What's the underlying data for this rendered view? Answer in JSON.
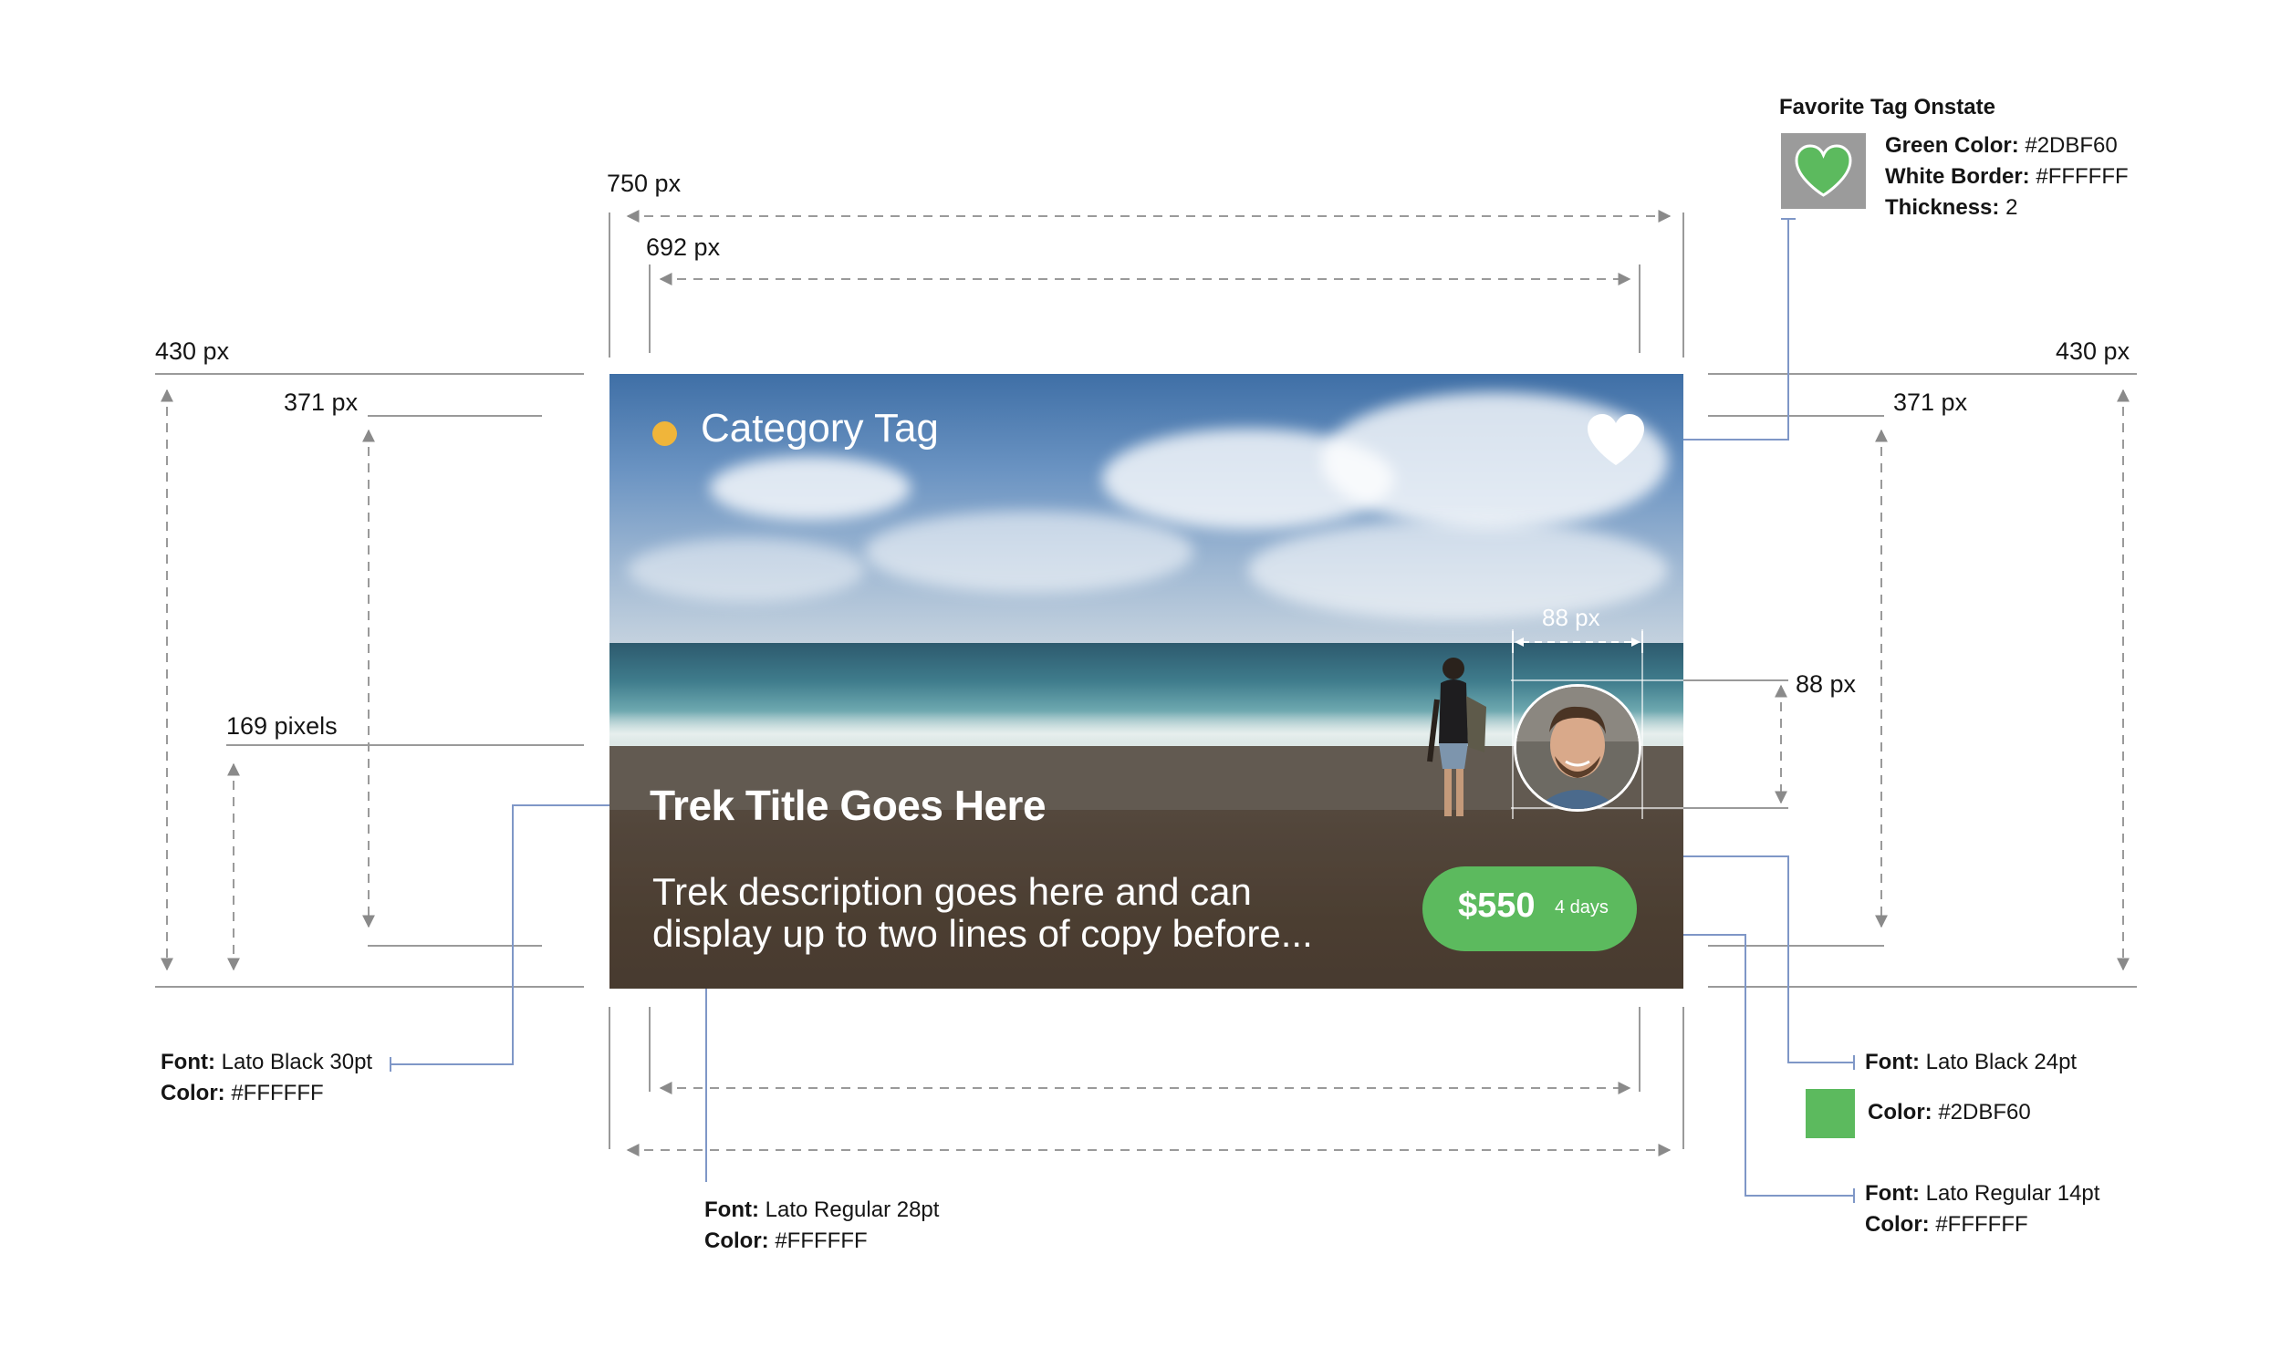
{
  "card": {
    "category_tag": "Category Tag",
    "title": "Trek Title Goes Here",
    "description_line1": "Trek description goes here and can",
    "description_line2": "display up to two lines of copy before...",
    "price": "$550",
    "duration": "4 days",
    "colors": {
      "accent_green": "#5CBA5E",
      "category_dot": "#F0B53A",
      "text": "#FFFFFF"
    },
    "icons": [
      "heart-icon",
      "avatar-photo",
      "category-dot"
    ]
  },
  "dimensions": {
    "total_width": "750 px",
    "content_width": "692 px",
    "left_height": "430 px",
    "left_inner_height": "371 px",
    "left_bottom_height": "169 pixels",
    "right_height": "430 px",
    "right_inner_height": "371 px",
    "avatar_width": "88 px",
    "avatar_height": "88 px"
  },
  "favorite_spec": {
    "heading": "Favorite Tag Onstate",
    "green_key": "Green Color:",
    "green_val": "#2DBF60",
    "border_key": "White Border:",
    "border_val": "#FFFFFF",
    "thickness_key": "Thickness:",
    "thickness_val": "2"
  },
  "title_spec": {
    "font_key": "Font:",
    "font_val": "Lato Black 30pt",
    "color_key": "Color:",
    "color_val": "#FFFFFF"
  },
  "desc_spec": {
    "font_key": "Font:",
    "font_val": "Lato Regular 28pt",
    "color_key": "Color:",
    "color_val": "#FFFFFF"
  },
  "price_spec": {
    "font_key": "Font:",
    "font_val": "Lato Black 24pt",
    "color_key": "Color:",
    "color_val": "#2DBF60",
    "swatch": "#5CBA5E"
  },
  "days_spec": {
    "font_key": "Font:",
    "font_val": "Lato Regular 14pt",
    "color_key": "Color:",
    "color_val": "#FFFFFF"
  }
}
